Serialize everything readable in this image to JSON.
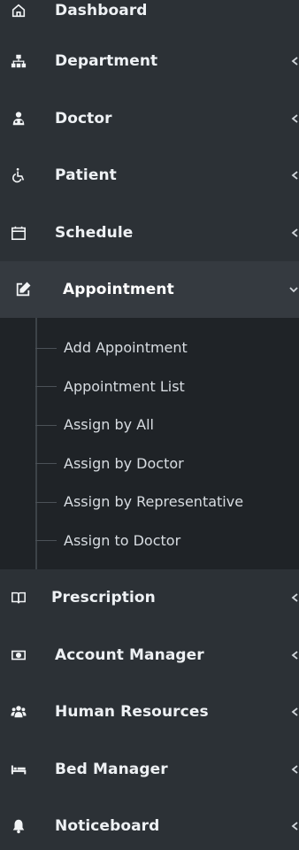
{
  "sidebar": {
    "items": [
      {
        "label": "Dashboard",
        "icon": "home-icon"
      },
      {
        "label": "Department",
        "icon": "sitemap-icon"
      },
      {
        "label": "Doctor",
        "icon": "doctor-icon"
      },
      {
        "label": "Patient",
        "icon": "wheelchair-icon"
      },
      {
        "label": "Schedule",
        "icon": "calendar-icon"
      },
      {
        "label": "Appointment",
        "icon": "edit-icon"
      },
      {
        "label": "Prescription",
        "icon": "book-icon"
      },
      {
        "label": "Account Manager",
        "icon": "money-icon"
      },
      {
        "label": "Human Resources",
        "icon": "users-icon"
      },
      {
        "label": "Bed Manager",
        "icon": "bed-icon"
      },
      {
        "label": "Noticeboard",
        "icon": "bell-icon"
      }
    ],
    "appointment_submenu": [
      "Add Appointment",
      "Appointment List",
      "Assign by All",
      "Assign by Doctor",
      "Assign by Representative",
      "Assign to Doctor"
    ],
    "colors": {
      "background": "#2c3136",
      "active_background": "#353a40",
      "submenu_background": "#1f2327",
      "text": "#eef1f4"
    }
  }
}
